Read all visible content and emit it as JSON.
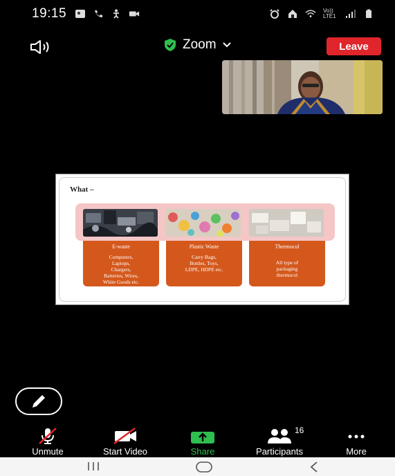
{
  "status_bar": {
    "time": "19:15",
    "network_label": "Vo)) LTE1",
    "left_icons": [
      "image-icon",
      "phone-call-icon",
      "accessibility-icon",
      "video-camera-icon"
    ],
    "right_icons": [
      "alarm-icon",
      "home-icon",
      "wifi-icon",
      "signal-icon",
      "battery-icon"
    ]
  },
  "top_bar": {
    "meeting_title": "Zoom",
    "leave_label": "Leave",
    "leave_color": "#e0252b",
    "shield_color": "#2fbf4f"
  },
  "slide": {
    "title": "What –",
    "cards": [
      {
        "title": "E-waste",
        "lines": [
          "Computers,",
          "Laptops,",
          "Chargers,",
          "Batteries, Wires,",
          "White Goods etc."
        ]
      },
      {
        "title": "Plastic Waste",
        "lines": [
          "Carry Bags,",
          "Bottles, Toys,",
          "LDPE, HDPE etc."
        ]
      },
      {
        "title": "Thermocol",
        "lines": [
          "All type of",
          "packaging",
          "thermocol"
        ]
      }
    ],
    "card_color": "#d4581c",
    "band_color": "#f4c6c6"
  },
  "toolbar": {
    "unmute_label": "Unmute",
    "start_video_label": "Start Video",
    "share_label": "Share",
    "participants_label": "Participants",
    "participants_count": "16",
    "more_label": "More",
    "share_color": "#2fbf4f"
  },
  "nav_bar": {
    "recent_glyph": "|||",
    "home_glyph": "○",
    "back_glyph": "<"
  }
}
